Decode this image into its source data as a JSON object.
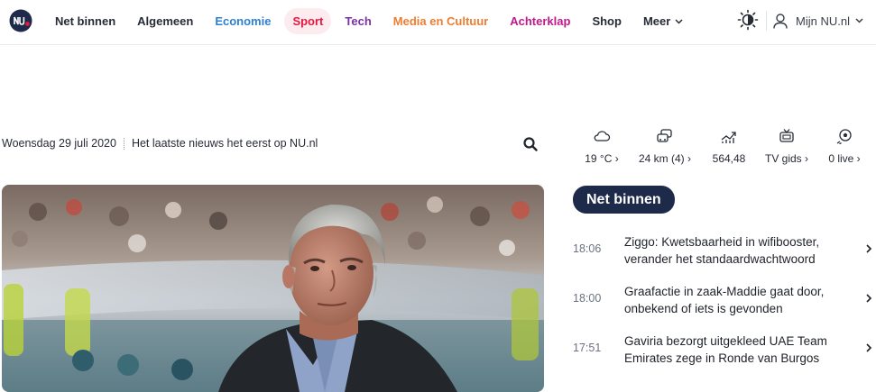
{
  "nav": {
    "items": [
      {
        "label": "Net binnen",
        "color": "#262b35",
        "active": false
      },
      {
        "label": "Algemeen",
        "color": "#262b35",
        "active": false
      },
      {
        "label": "Economie",
        "color": "#2d7fd3",
        "active": false
      },
      {
        "label": "Sport",
        "color": "#e8173f",
        "active": true
      },
      {
        "label": "Tech",
        "color": "#7b2fa8",
        "active": false
      },
      {
        "label": "Media en Cultuur",
        "color": "#ef7d31",
        "active": false
      },
      {
        "label": "Achterklap",
        "color": "#c2188a",
        "active": false
      },
      {
        "label": "Shop",
        "color": "#262b35",
        "active": false
      },
      {
        "label": "Meer",
        "color": "#262b35",
        "active": false
      }
    ],
    "account_label": "Mijn NU.nl",
    "icons": {
      "logo": "nu-logo",
      "theme": "contrast-icon",
      "account": "user-icon"
    }
  },
  "date_row": {
    "date": "Woensdag 29 juli 2020",
    "tagline": "Het laatste nieuws het eerst op NU.nl"
  },
  "widgets": [
    {
      "icon": "cloud-icon",
      "label": "19 °C"
    },
    {
      "icon": "traffic-icon",
      "label": "24 km (4)"
    },
    {
      "icon": "stock-chart-icon",
      "label": "564,48"
    },
    {
      "icon": "tv-icon",
      "label": "TV gids"
    },
    {
      "icon": "live-ball-icon",
      "label": "0 live"
    }
  ],
  "net_binnen": {
    "heading": "Net binnen",
    "items": [
      {
        "time": "18:06",
        "title": "Ziggo: Kwetsbaarheid in wifibooster, verander het standaardwachtwoord"
      },
      {
        "time": "18:00",
        "title": "Graafactie in zaak-Maddie gaat door, onbekend of iets is gevonden"
      },
      {
        "time": "17:51",
        "title": "Gaviria bezorgt uitgekleed UAE Team Emirates zege in Ronde van Burgos"
      }
    ]
  },
  "colors": {
    "navy": "#1e2a4a",
    "sport_red": "#e8173f",
    "active_bg": "#fdecef"
  }
}
